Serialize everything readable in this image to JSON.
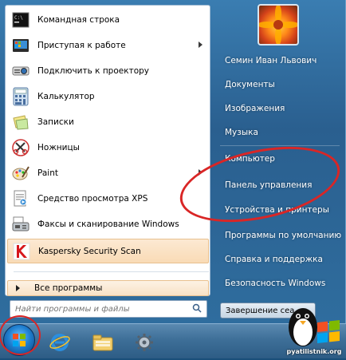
{
  "left_pane": {
    "items": [
      {
        "label": "Командная строка",
        "icon": "command-prompt-icon",
        "has_submenu": false
      },
      {
        "label": "Приступая к работе",
        "icon": "getting-started-icon",
        "has_submenu": true
      },
      {
        "label": "Подключить к проектору",
        "icon": "projector-icon",
        "has_submenu": false
      },
      {
        "label": "Калькулятор",
        "icon": "calculator-icon",
        "has_submenu": false
      },
      {
        "label": "Записки",
        "icon": "sticky-notes-icon",
        "has_submenu": true
      },
      {
        "label": "Ножницы",
        "icon": "snipping-tool-icon",
        "has_submenu": false
      },
      {
        "label": "Paint",
        "icon": "paint-icon",
        "has_submenu": true
      },
      {
        "label": "Средство просмотра XPS",
        "icon": "xps-viewer-icon",
        "has_submenu": false
      },
      {
        "label": "Факсы и сканирование Windows",
        "icon": "fax-scan-icon",
        "has_submenu": false
      },
      {
        "label": "Kaspersky Security Scan",
        "icon": "kaspersky-icon",
        "has_submenu": false,
        "highlighted": true
      }
    ],
    "all_programs": "Все программы",
    "search_placeholder": "Найти программы и файлы"
  },
  "right_pane": {
    "items": [
      "Семин Иван Львович",
      "Документы",
      "Изображения",
      "Музыка",
      "Компьютер",
      "Панель управления",
      "Устройства и принтеры",
      "Программы по умолчанию",
      "Справка и поддержка",
      "Безопасность Windows"
    ],
    "shutdown_label": "Завершение сеа"
  },
  "taskbar": {
    "buttons": [
      "start-orb",
      "internet-explorer-icon",
      "file-explorer-icon",
      "control-panel-icon"
    ]
  },
  "watermark": {
    "text": "pyatilistnik.org"
  },
  "colors": {
    "annotation_red": "#d92626",
    "highlight": "#f9dbb6"
  }
}
